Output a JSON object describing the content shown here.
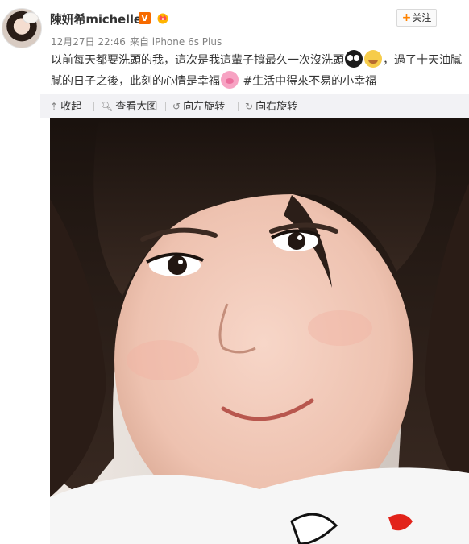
{
  "post": {
    "username": "陳妍希michelle",
    "vip_badge": "V",
    "follow_label": "关注",
    "timestamp": "12月27日 22:46",
    "source": "来自 iPhone 6s Plus",
    "text_part1": "以前每天都要洗頭的我，這次是我這輩子撐最久一次沒洗頭",
    "text_part2": "，過了十天油膩膩的日子之後，此刻的心情是幸福",
    "hashtag": "#生活中得來不易的小幸福"
  },
  "toolbar": {
    "collapse_label": "收起",
    "view_large_label": "查看大图",
    "rotate_left_label": "向左旋转",
    "rotate_right_label": "向右旋转"
  },
  "colors": {
    "accent": "#ff8200",
    "vip": "#f76b00",
    "toolbar_bg": "#f2f2f5",
    "meta_text": "#808080"
  },
  "icons": [
    "avatar",
    "vip-icon",
    "crown-icon",
    "plus-icon",
    "collapse-icon",
    "search-icon",
    "rotate-left-icon",
    "rotate-right-icon"
  ]
}
